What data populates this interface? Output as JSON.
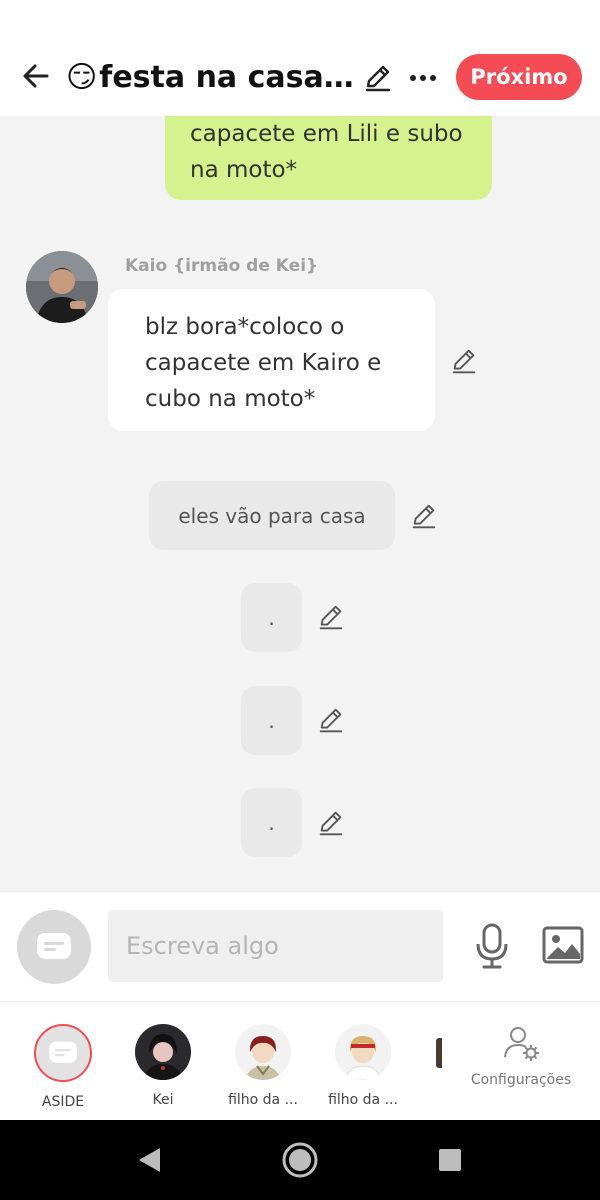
{
  "header": {
    "title_emoji": "😏",
    "title": "festa na casa ...",
    "next_label": "Próximo"
  },
  "messages": {
    "own_text": "capacete em Lili e subo na moto*",
    "kaio_name": "Kaio {irmão de Kei}",
    "kaio_text": "blz bora*coloco o capacete em Kairo e cubo na moto*",
    "narration_1": "eles vão para casa",
    "narration_2": ".",
    "narration_3": ".",
    "narration_4": "."
  },
  "input": {
    "placeholder": "Escreva algo"
  },
  "characters": [
    {
      "label": "ASIDE"
    },
    {
      "label": "Kei"
    },
    {
      "label": "filho da ..."
    },
    {
      "label": "filho da ..."
    }
  ],
  "settings_label": "Configurações",
  "colors": {
    "accent": "#f54b55",
    "own_bubble": "#d5f28f",
    "background": "#f3f3f3"
  },
  "icons": [
    "back-arrow-icon",
    "pencil-icon",
    "more-icon",
    "chat-bubble-icon",
    "microphone-icon",
    "image-icon",
    "user-gear-icon",
    "nav-back-icon",
    "nav-home-icon",
    "nav-recent-icon"
  ]
}
